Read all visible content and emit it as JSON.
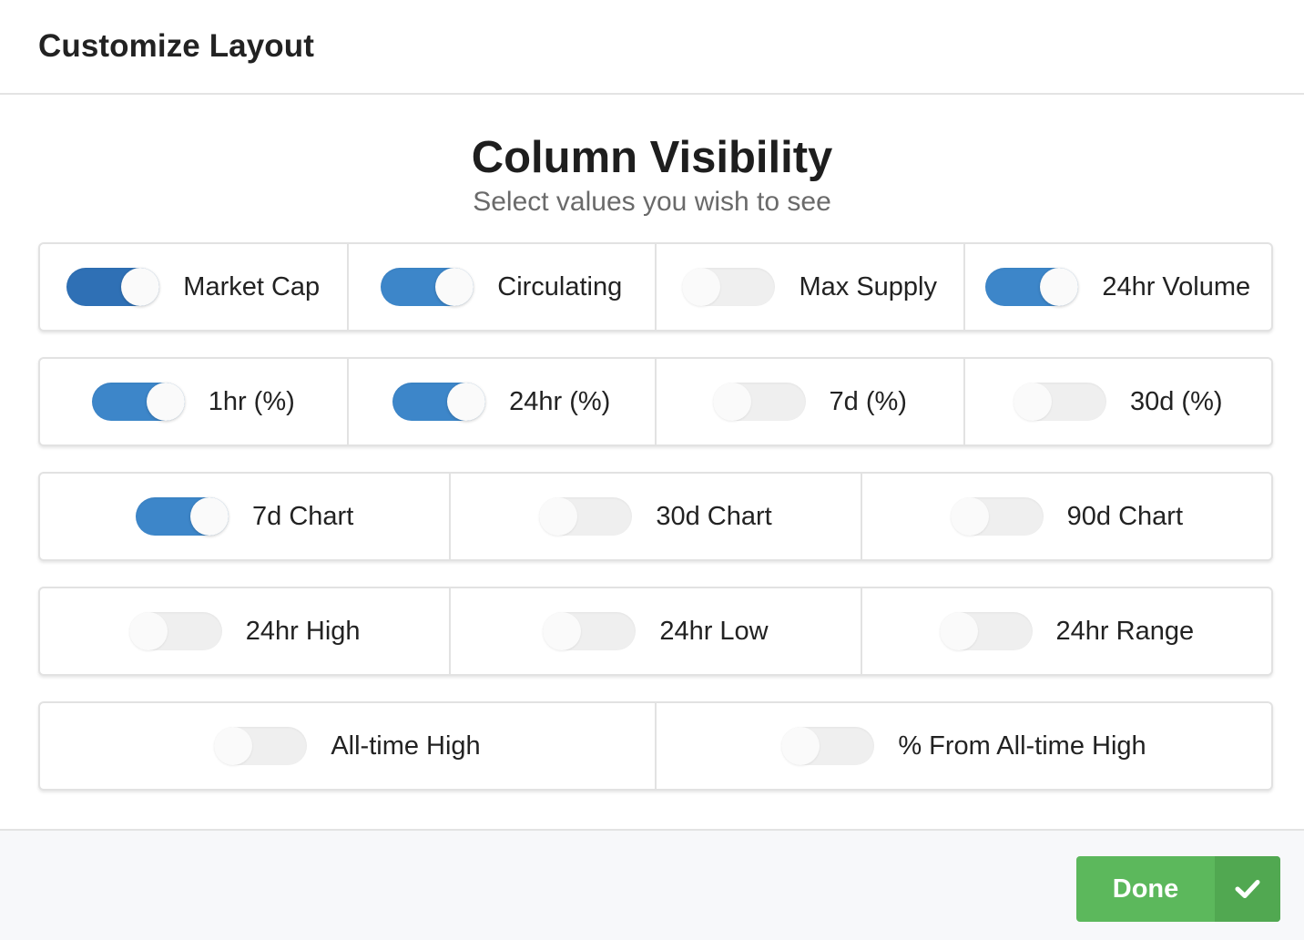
{
  "header": {
    "title": "Customize Layout"
  },
  "section": {
    "title": "Column Visibility",
    "subtitle": "Select values you wish to see"
  },
  "rows": [
    [
      {
        "label": "Market Cap",
        "enabled": true
      },
      {
        "label": "Circulating",
        "enabled": true
      },
      {
        "label": "Max Supply",
        "enabled": false
      },
      {
        "label": "24hr Volume",
        "enabled": true
      }
    ],
    [
      {
        "label": "1hr (%)",
        "enabled": true
      },
      {
        "label": "24hr (%)",
        "enabled": true
      },
      {
        "label": "7d (%)",
        "enabled": false
      },
      {
        "label": "30d (%)",
        "enabled": false
      }
    ],
    [
      {
        "label": "7d Chart",
        "enabled": true
      },
      {
        "label": "30d Chart",
        "enabled": false
      },
      {
        "label": "90d Chart",
        "enabled": false
      }
    ],
    [
      {
        "label": "24hr High",
        "enabled": false
      },
      {
        "label": "24hr Low",
        "enabled": false
      },
      {
        "label": "24hr Range",
        "enabled": false
      }
    ],
    [
      {
        "label": "All-time High",
        "enabled": false
      },
      {
        "label": "% From All-time High",
        "enabled": false
      }
    ]
  ],
  "footer": {
    "done_label": "Done",
    "done_icon": "checkmark-icon"
  },
  "colors": {
    "toggle_on": "#3d86c9",
    "toggle_off": "#efefef",
    "done_button": "#5cb85c"
  }
}
